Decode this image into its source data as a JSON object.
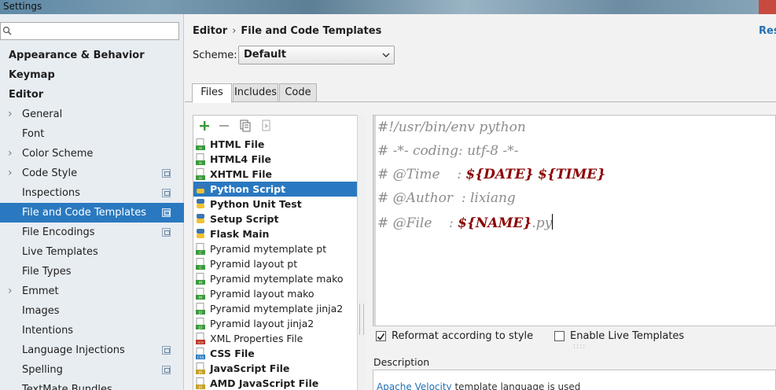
{
  "window": {
    "title": "Settings"
  },
  "sidebar": {
    "search_placeholder": "",
    "items": [
      {
        "label": "Appearance & Behavior",
        "bold": true,
        "arrow": false,
        "project": false,
        "indent": 1
      },
      {
        "label": "Keymap",
        "bold": true,
        "arrow": false,
        "project": false,
        "indent": 1
      },
      {
        "label": "Editor",
        "bold": true,
        "arrow": false,
        "project": false,
        "indent": 1
      },
      {
        "label": "General",
        "bold": false,
        "arrow": true,
        "project": false,
        "indent": 2
      },
      {
        "label": "Font",
        "bold": false,
        "arrow": false,
        "project": false,
        "indent": 2
      },
      {
        "label": "Color Scheme",
        "bold": false,
        "arrow": true,
        "project": false,
        "indent": 2
      },
      {
        "label": "Code Style",
        "bold": false,
        "arrow": true,
        "project": true,
        "indent": 2
      },
      {
        "label": "Inspections",
        "bold": false,
        "arrow": false,
        "project": true,
        "indent": 2
      },
      {
        "label": "File and Code Templates",
        "bold": false,
        "arrow": false,
        "project": true,
        "indent": 2,
        "selected": true
      },
      {
        "label": "File Encodings",
        "bold": false,
        "arrow": false,
        "project": true,
        "indent": 2
      },
      {
        "label": "Live Templates",
        "bold": false,
        "arrow": false,
        "project": false,
        "indent": 2
      },
      {
        "label": "File Types",
        "bold": false,
        "arrow": false,
        "project": false,
        "indent": 2
      },
      {
        "label": "Emmet",
        "bold": false,
        "arrow": true,
        "project": false,
        "indent": 2
      },
      {
        "label": "Images",
        "bold": false,
        "arrow": false,
        "project": false,
        "indent": 2
      },
      {
        "label": "Intentions",
        "bold": false,
        "arrow": false,
        "project": false,
        "indent": 2
      },
      {
        "label": "Language Injections",
        "bold": false,
        "arrow": false,
        "project": true,
        "indent": 2
      },
      {
        "label": "Spelling",
        "bold": false,
        "arrow": false,
        "project": true,
        "indent": 2
      },
      {
        "label": "TextMate Bundles",
        "bold": false,
        "arrow": false,
        "project": false,
        "indent": 2
      }
    ]
  },
  "header": {
    "breadcrumb_parent": "Editor",
    "breadcrumb_sep": "›",
    "breadcrumb_current": "File and Code Templates",
    "reset_label": "Reset"
  },
  "scheme": {
    "label": "Scheme:",
    "value": "Default"
  },
  "tabs": [
    {
      "label": "Files",
      "active": true
    },
    {
      "label": "Includes",
      "active": false
    },
    {
      "label": "Code",
      "active": false
    }
  ],
  "templates": [
    {
      "label": "HTML File",
      "bold": true,
      "icon": "html-file-icon"
    },
    {
      "label": "HTML4 File",
      "bold": true,
      "icon": "html-file-icon"
    },
    {
      "label": "XHTML File",
      "bold": true,
      "icon": "html-file-icon"
    },
    {
      "label": "Python Script",
      "bold": true,
      "icon": "python-file-icon",
      "selected": true
    },
    {
      "label": "Python Unit Test",
      "bold": true,
      "icon": "python-file-icon"
    },
    {
      "label": "Setup Script",
      "bold": true,
      "icon": "python-file-icon"
    },
    {
      "label": "Flask Main",
      "bold": true,
      "icon": "python-file-icon"
    },
    {
      "label": "Pyramid mytemplate pt",
      "bold": false,
      "icon": "chameleon-file-icon"
    },
    {
      "label": "Pyramid layout pt",
      "bold": false,
      "icon": "chameleon-file-icon"
    },
    {
      "label": "Pyramid mytemplate mako",
      "bold": false,
      "icon": "mako-file-icon"
    },
    {
      "label": "Pyramid layout mako",
      "bold": false,
      "icon": "mako-file-icon"
    },
    {
      "label": "Pyramid mytemplate jinja2",
      "bold": false,
      "icon": "jinja2-file-icon"
    },
    {
      "label": "Pyramid layout jinja2",
      "bold": false,
      "icon": "jinja2-file-icon"
    },
    {
      "label": "XML Properties File",
      "bold": false,
      "icon": "xml-file-icon"
    },
    {
      "label": "CSS File",
      "bold": true,
      "icon": "css-file-icon"
    },
    {
      "label": "JavaScript File",
      "bold": true,
      "icon": "js-file-icon"
    },
    {
      "label": "AMD JavaScript File",
      "bold": true,
      "icon": "js-file-icon"
    }
  ],
  "editor": {
    "line1": "#!/usr/bin/env python",
    "line2": "# -*- coding: utf-8 -*-",
    "line3_prefix": "# @Time    : ",
    "line3_var1": "${DATE}",
    "line3_var2": "${TIME}",
    "line4": "# @Author  : lixiang",
    "line5_prefix": "# @File    : ",
    "line5_var": "${NAME}",
    "line5_suffix": ".py"
  },
  "options": {
    "reformat_label": "Reformat according to style",
    "reformat_checked": true,
    "live_templates_label": "Enable Live Templates",
    "live_templates_checked": false
  },
  "description": {
    "label": "Description",
    "link_text": "Apache Velocity",
    "text": " template language is used"
  },
  "colors": {
    "selection": "#2a79c0",
    "variable": "#8b0000",
    "comment": "#8c8c8c",
    "link": "#2470b3"
  }
}
